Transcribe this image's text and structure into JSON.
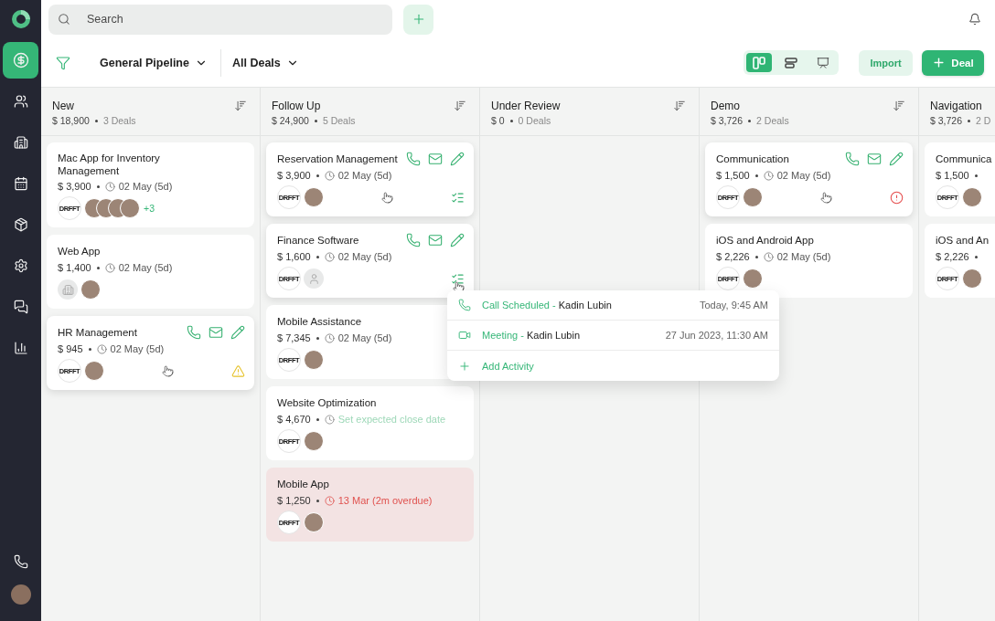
{
  "sidebar": {
    "items": [
      {
        "kind": "deals",
        "selected": true
      },
      {
        "kind": "contacts",
        "selected": false
      },
      {
        "kind": "companies",
        "selected": false
      },
      {
        "kind": "calendar",
        "selected": false
      },
      {
        "kind": "products",
        "selected": false
      },
      {
        "kind": "settings",
        "selected": false
      },
      {
        "kind": "messages",
        "selected": false
      },
      {
        "kind": "reports",
        "selected": false
      }
    ]
  },
  "search": {
    "placeholder": "Search"
  },
  "toolbar": {
    "pipeline": "General Pipeline",
    "filter": "All Deals",
    "views": [
      {
        "kind": "board",
        "selected": true
      },
      {
        "kind": "list",
        "selected": false
      },
      {
        "kind": "chart",
        "selected": false
      }
    ],
    "import_label": "Import",
    "add_label": "Deal"
  },
  "columns": [
    {
      "title": "New",
      "amount": "$ 18,900",
      "count": "3 Deals",
      "deals": [
        {
          "title": "Mac App for Inventory Management",
          "amount": "$ 3,900",
          "date": "02 May (5d)",
          "date_set": true,
          "overdue": false,
          "company": {
            "kind": "logo",
            "label": "DRFFT"
          },
          "avatars": [
            {
              "kind": "photo"
            },
            {
              "kind": "photo"
            },
            {
              "kind": "photo"
            },
            {
              "kind": "photo"
            }
          ],
          "more": "+3",
          "hovered": false
        },
        {
          "title": "Web App",
          "amount": "$ 1,400",
          "date": "02 May (5d)",
          "date_set": true,
          "overdue": false,
          "company": {
            "kind": "placeholder"
          },
          "avatars": [
            {
              "kind": "photo"
            }
          ],
          "hovered": false
        },
        {
          "title": "HR Management",
          "amount": "$ 945",
          "date": "02 May (5d)",
          "date_set": true,
          "overdue": false,
          "company": {
            "kind": "logo",
            "label": "DRFFT"
          },
          "avatars": [
            {
              "kind": "photo"
            }
          ],
          "hovered": true,
          "status": {
            "kind": "warning"
          }
        }
      ]
    },
    {
      "title": "Follow Up",
      "amount": "$ 24,900",
      "count": "5 Deals",
      "deals": [
        {
          "title": "Reservation Management",
          "amount": "$ 3,900",
          "date": "02 May (5d)",
          "date_set": true,
          "overdue": false,
          "company": {
            "kind": "logo",
            "label": "DRFFT"
          },
          "avatars": [
            {
              "kind": "photo"
            }
          ],
          "hovered": true,
          "status": {
            "kind": "tasks"
          }
        },
        {
          "title": "Finance Software",
          "amount": "$ 1,600",
          "date": "02 May (5d)",
          "date_set": true,
          "overdue": false,
          "company": {
            "kind": "logo",
            "label": "DRFFT"
          },
          "avatars": [
            {
              "kind": "default"
            }
          ],
          "hovered": true,
          "status": {
            "kind": "tasks"
          },
          "activity_menu": {
            "open": true,
            "items": [
              {
                "kind": "call",
                "type": "Call Scheduled -",
                "person": "Kadin Lubin",
                "time": "Today, 9:45 AM"
              },
              {
                "kind": "meeting",
                "type": "Meeting -",
                "person": "Kadin Lubin",
                "time": "27 Jun 2023, 11:30 AM"
              }
            ],
            "add_label": "Add Activity"
          }
        },
        {
          "title": "Mobile Assistance",
          "amount": "$ 7,345",
          "date": "02 May (5d)",
          "date_set": true,
          "overdue": false,
          "company": {
            "kind": "logo",
            "label": "DRFFT"
          },
          "avatars": [
            {
              "kind": "photo"
            }
          ],
          "hovered": false
        },
        {
          "title": "Website Optimization",
          "amount": "$ 4,670",
          "date": "Set expected close date",
          "date_set": false,
          "overdue": false,
          "company": {
            "kind": "logo",
            "label": "DRFFT"
          },
          "avatars": [
            {
              "kind": "photo"
            }
          ],
          "hovered": false
        },
        {
          "title": "Mobile App",
          "amount": "$ 1,250",
          "date": "13 Mar (2m overdue)",
          "date_set": true,
          "overdue": true,
          "company": {
            "kind": "logo",
            "label": "DRFFT"
          },
          "avatars": [
            {
              "kind": "photo"
            }
          ],
          "hovered": false
        }
      ]
    },
    {
      "title": "Under Review",
      "amount": "$ 0",
      "count": "0 Deals"
    },
    {
      "title": "Demo",
      "amount": "$ 3,726",
      "count": "2 Deals",
      "deals": [
        {
          "title": "Communication",
          "amount": "$ 1,500",
          "date": "02 May (5d)",
          "date_set": true,
          "overdue": false,
          "company": {
            "kind": "logo",
            "label": "DRFFT"
          },
          "avatars": [
            {
              "kind": "photo"
            }
          ],
          "hovered": true,
          "status": {
            "kind": "alert"
          }
        },
        {
          "title": "iOS and Android App",
          "amount": "$ 2,226",
          "date": "02 May (5d)",
          "date_set": true,
          "overdue": false,
          "company": {
            "kind": "logo",
            "label": "DRFFT"
          },
          "avatars": [
            {
              "kind": "photo"
            }
          ],
          "hovered": false
        }
      ]
    },
    {
      "title": "Navigation",
      "amount": "$ 3,726",
      "count": "2 D",
      "deals": [
        {
          "title": "Communica",
          "amount": "$ 1,500",
          "company": {
            "kind": "logo",
            "label": "DRFFT"
          },
          "avatars": [
            {
              "kind": "photo"
            }
          ],
          "hovered": false
        },
        {
          "title": "iOS and An",
          "amount": "$ 2,226",
          "company": {
            "kind": "logo",
            "label": "DRFFT"
          },
          "avatars": [
            {
              "kind": "photo"
            }
          ],
          "hovered": false
        }
      ]
    }
  ]
}
